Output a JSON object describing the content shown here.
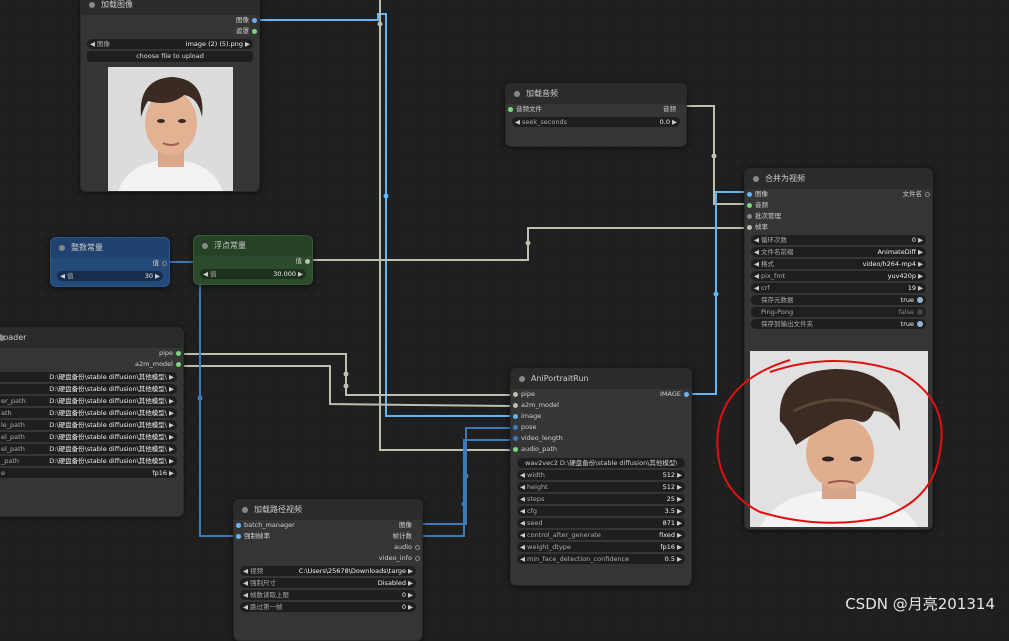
{
  "colors": {
    "pipe": "#b8c0b0",
    "image": "#64b5f6",
    "audio": "#7cd67c",
    "accent_red": "#e01010"
  },
  "load_image": {
    "title": "加载图像",
    "out_image": "图像",
    "out_mask": "遮罩",
    "image_label": "图像",
    "image_value": "image (2) (5).png",
    "upload": "choose file to upload"
  },
  "load_audio": {
    "title": "加载音频",
    "in_audio_file": "音频文件",
    "out_audio": "音频",
    "seek_label": "seek_seconds",
    "seek_value": "0.0"
  },
  "int_const": {
    "title": "整数常量",
    "out": "值",
    "value_label": "值",
    "value": "30"
  },
  "float_const": {
    "title": "浮点常量",
    "out": "值",
    "value_label": "值",
    "value": "30.000"
  },
  "loader": {
    "title": "Loader",
    "out_pipe": "pipe",
    "out_a2m": "a2m_model",
    "rows": [
      {
        "label": "",
        "value": "D:\\硬盘备份\\stable diffusion\\其他模型\\"
      },
      {
        "label": "",
        "value": "D:\\硬盘备份\\stable diffusion\\其他模型\\"
      },
      {
        "label": "er_path",
        "value": "D:\\硬盘备份\\stable diffusion\\其他模型\\"
      },
      {
        "label": "ath",
        "value": "D:\\硬盘备份\\stable diffusion\\其他模型\\"
      },
      {
        "label": "le_path",
        "value": "D:\\硬盘备份\\stable diffusion\\其他模型\\"
      },
      {
        "label": "el_path",
        "value": "D:\\硬盘备份\\stable diffusion\\其他模型\\"
      },
      {
        "label": "el_path",
        "value": "D:\\硬盘备份\\stable diffusion\\其他模型\\"
      },
      {
        "label": "_path",
        "value": "D:\\硬盘备份\\stable diffusion\\其他模型\\"
      },
      {
        "label": "e",
        "value": "fp16"
      }
    ]
  },
  "aniportrait": {
    "title": "AniPortraitRun",
    "inputs": [
      "pipe",
      "a2m_model",
      "image",
      "pose",
      "video_length",
      "audio_path"
    ],
    "out_image": "IMAGE",
    "wav": "wav2vec2 D:\\硬盘备份\\stable diffusion\\其他模型\\",
    "params": [
      {
        "label": "width",
        "value": "512"
      },
      {
        "label": "height",
        "value": "512"
      },
      {
        "label": "steps",
        "value": "25"
      },
      {
        "label": "cfg",
        "value": "3.5"
      },
      {
        "label": "seed",
        "value": "871"
      },
      {
        "label": "control_after_generate",
        "value": "fixed"
      },
      {
        "label": "weight_dtype",
        "value": "fp16"
      },
      {
        "label": "min_face_detection_confidence",
        "value": "0.5"
      }
    ]
  },
  "load_video": {
    "title": "加载路径视频",
    "in_batch": "batch_manager",
    "in_force_rate": "强制帧率",
    "out_image": "图像",
    "out_frames": "帧计数",
    "out_audio": "audio",
    "out_info": "video_info",
    "params": [
      {
        "label": "视频",
        "value": "C:\\Users\\25678\\Downloads\\targe"
      },
      {
        "label": "强制尺寸",
        "value": "Disabled"
      },
      {
        "label": "帧数读取上限",
        "value": "0"
      },
      {
        "label": "跳过第一帧",
        "value": "0"
      }
    ]
  },
  "combine": {
    "title": "合并为视频",
    "inputs": [
      "图像",
      "音频",
      "批次管理",
      "帧率"
    ],
    "out_filename": "文件名",
    "params": [
      {
        "label": "循环次数",
        "value": "0"
      },
      {
        "label": "文件名前缀",
        "value": "AnimateDiff"
      },
      {
        "label": "格式",
        "value": "video/h264-mp4"
      },
      {
        "label": "pix_fmt",
        "value": "yuv420p"
      },
      {
        "label": "crf",
        "value": "19"
      }
    ],
    "toggles": [
      {
        "label": "保存元数据",
        "value": "true"
      },
      {
        "label": "Ping-Pong",
        "value": "false"
      },
      {
        "label": "保存到输出文件夹",
        "value": "true"
      }
    ]
  },
  "watermark": "CSDN @月亮201314"
}
